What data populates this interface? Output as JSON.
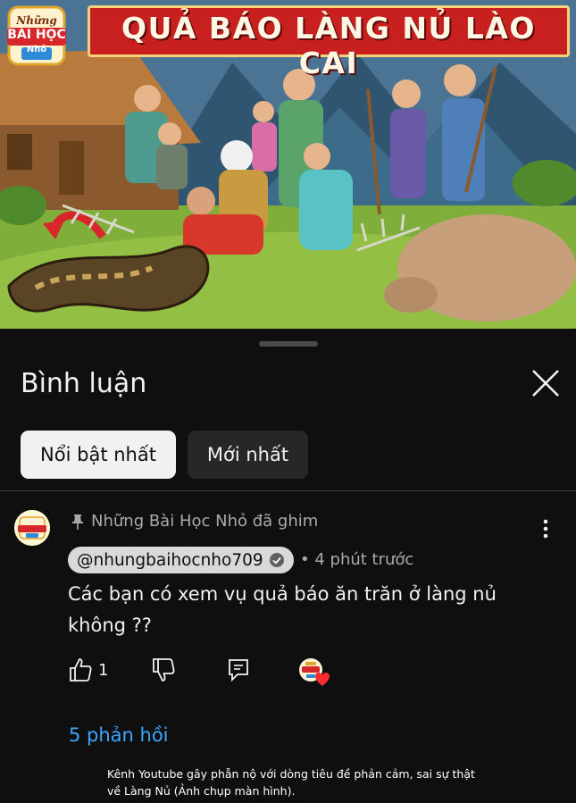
{
  "video": {
    "banner_title": "QUẢ BÁO LÀNG NỦ LÀO CAI",
    "logo_line1": "Những",
    "logo_line2": "BÀI HỌC",
    "logo_line3": "Nhỏ"
  },
  "comments_panel": {
    "title": "Bình luận",
    "close_icon": "close-icon",
    "filters": [
      {
        "label": "Nổi bật nhất",
        "active": true
      },
      {
        "label": "Mới nhất",
        "active": false
      }
    ]
  },
  "comment": {
    "pinned_text": "Những Bài Học Nhỏ đã ghim",
    "author": "@nhungbaihocnho709",
    "time": "• 4 phút trước",
    "text": "Các bạn có xem vụ quả báo ăn trăn ở làng nủ không ??",
    "like_count": "1",
    "replies_label": "5 phản hồi"
  },
  "caption": "Kênh Youtube gây phẫn nộ với dòng tiêu đề phản cảm, sai sự thật về Làng Nủ (Ảnh chụp màn hình).",
  "colors": {
    "background": "#0f0f0f",
    "banner_red": "#c81f1f",
    "link_blue": "#3ea6ff",
    "chip_active": "#f1f1f1",
    "chip_inactive": "#272727"
  }
}
